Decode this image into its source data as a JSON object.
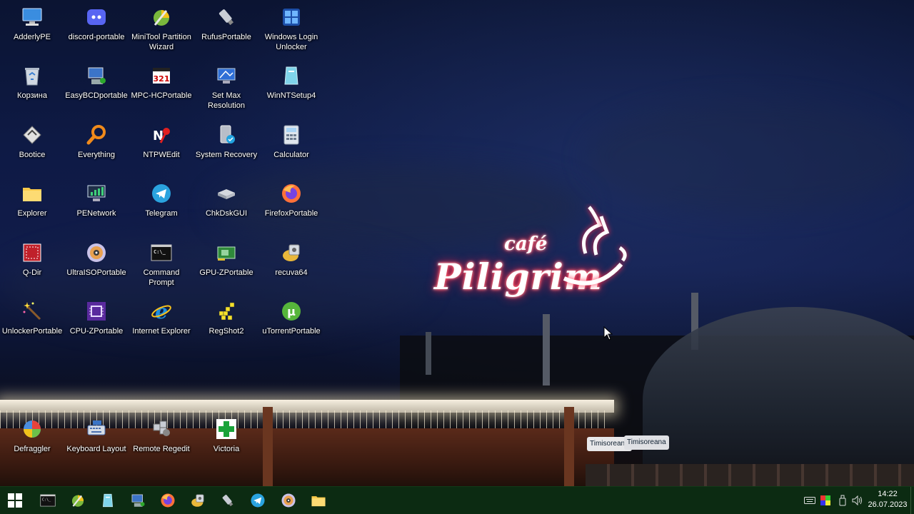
{
  "desktop": {
    "icons": [
      {
        "label": "AdderlyPE",
        "icon": "computer-icon"
      },
      {
        "label": "discord-portable",
        "icon": "discord-icon"
      },
      {
        "label": "MiniTool Partition Wizard",
        "icon": "partition-wizard-icon"
      },
      {
        "label": "RufusPortable",
        "icon": "usb-drive-icon"
      },
      {
        "label": "Windows Login Unlocker",
        "icon": "login-unlocker-icon"
      },
      {
        "label": "Корзина",
        "icon": "recycle-bin-icon"
      },
      {
        "label": "EasyBCDportable",
        "icon": "easybcd-icon"
      },
      {
        "label": "MPC-HCPortable",
        "icon": "media-player-icon"
      },
      {
        "label": "Set Max Resolution",
        "icon": "monitor-resolution-icon"
      },
      {
        "label": "WinNTSetup4",
        "icon": "winntsetup-icon"
      },
      {
        "label": "Bootice",
        "icon": "bootice-icon"
      },
      {
        "label": "Everything",
        "icon": "magnifier-icon"
      },
      {
        "label": "NTPWEdit",
        "icon": "ntpwedit-icon"
      },
      {
        "label": "System Recovery",
        "icon": "system-recovery-icon"
      },
      {
        "label": "Calculator",
        "icon": "calculator-icon"
      },
      {
        "label": "Explorer",
        "icon": "folder-icon"
      },
      {
        "label": "PENetwork",
        "icon": "network-icon"
      },
      {
        "label": "Telegram",
        "icon": "telegram-icon"
      },
      {
        "label": "ChkDskGUI",
        "icon": "hard-drive-icon"
      },
      {
        "label": "FirefoxPortable",
        "icon": "firefox-icon"
      },
      {
        "label": "Q-Dir",
        "icon": "q-dir-icon"
      },
      {
        "label": "UltraISOPortable",
        "icon": "disc-icon"
      },
      {
        "label": "Command Prompt",
        "icon": "terminal-icon"
      },
      {
        "label": "GPU-ZPortable",
        "icon": "gpu-icon"
      },
      {
        "label": "recuva64",
        "icon": "recuva-icon"
      },
      {
        "label": "UnlockerPortable",
        "icon": "magic-wand-icon"
      },
      {
        "label": "CPU-ZPortable",
        "icon": "cpu-icon"
      },
      {
        "label": "Internet Explorer",
        "icon": "internet-explorer-icon"
      },
      {
        "label": "RegShot2",
        "icon": "regshot-icon"
      },
      {
        "label": "uTorrentPortable",
        "icon": "utorrent-icon"
      },
      {
        "label": "Defraggler",
        "icon": "defraggler-icon"
      },
      {
        "label": "Keyboard Layout",
        "icon": "keyboard-icon"
      },
      {
        "label": "Remote Regedit",
        "icon": "remote-regedit-icon"
      },
      {
        "label": "Victoria",
        "icon": "victoria-cross-icon"
      }
    ]
  },
  "wallpaper": {
    "sign_small": "café",
    "sign_large": "Piligrim",
    "banner_1": "Timisoreana",
    "banner_2": "Timisoreana"
  },
  "taskbar": {
    "start": "windows-start-icon",
    "pinned": [
      "terminal-icon",
      "partition-wizard-icon",
      "winntsetup-icon",
      "easybcd-icon",
      "firefox-icon",
      "recuva-icon",
      "usb-drive-icon",
      "telegram-icon",
      "disc-icon",
      "folder-icon"
    ],
    "tray": [
      "keyboard-icon",
      "color-icon",
      "usb-safely-remove-icon",
      "volume-icon"
    ],
    "time": "14:22",
    "date": "26.07.2023"
  },
  "colors": {
    "taskbar_bg": "#0c2b12",
    "neon_red": "#ff2040"
  }
}
